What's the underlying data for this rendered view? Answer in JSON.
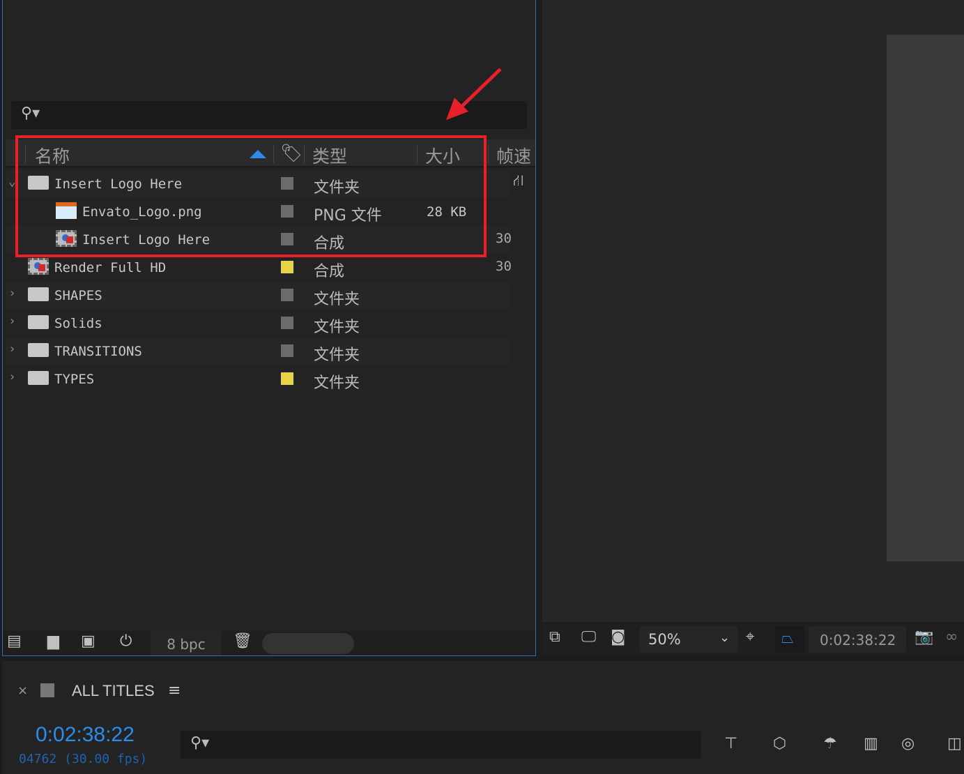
{
  "project": {
    "columns": {
      "name": "名称",
      "type": "类型",
      "size": "大小",
      "fps": "帧速"
    },
    "rows": [
      {
        "name": "Insert Logo Here",
        "type": "文件夹",
        "size": "",
        "fps": "",
        "icon": "folder-icon",
        "tag": "#6b6b6b",
        "indent": 0,
        "expanded": true
      },
      {
        "name": "Envato_Logo.png",
        "type": "PNG 文件",
        "size": "28 KB",
        "fps": "",
        "icon": "png-file-icon",
        "tag": "#6b6b6b",
        "indent": 2
      },
      {
        "name": "Insert Logo Here",
        "type": "合成",
        "size": "",
        "fps": "30",
        "icon": "composition-icon",
        "tag": "#6b6b6b",
        "indent": 2
      },
      {
        "name": "Render Full HD",
        "type": "合成",
        "size": "",
        "fps": "30",
        "icon": "composition-icon",
        "tag": "#e6d34a",
        "indent": 0
      },
      {
        "name": "SHAPES",
        "type": "文件夹",
        "size": "",
        "fps": "",
        "icon": "folder-icon",
        "tag": "#6b6b6b",
        "indent": 1,
        "collapsed": true
      },
      {
        "name": "Solids",
        "type": "文件夹",
        "size": "",
        "fps": "",
        "icon": "folder-icon",
        "tag": "#6b6b6b",
        "indent": 1,
        "collapsed": true
      },
      {
        "name": "TRANSITIONS",
        "type": "文件夹",
        "size": "",
        "fps": "",
        "icon": "folder-icon",
        "tag": "#6b6b6b",
        "indent": 1,
        "collapsed": true
      },
      {
        "name": "TYPES",
        "type": "文件夹",
        "size": "",
        "fps": "",
        "icon": "folder-icon",
        "tag": "#e6d34a",
        "indent": 1,
        "collapsed": true
      }
    ],
    "bpc": "8 bpc"
  },
  "viewer": {
    "zoom": "50%",
    "timecode": "0:02:38:22"
  },
  "timeline": {
    "tab_title": "ALL TITLES",
    "close": "×",
    "menu": "≡",
    "timecode": "0:02:38:22",
    "frame_info": "04762 (30.00 fps)"
  },
  "colors": {
    "accent": "#2d8ceb",
    "annotation": "#e8202a"
  }
}
